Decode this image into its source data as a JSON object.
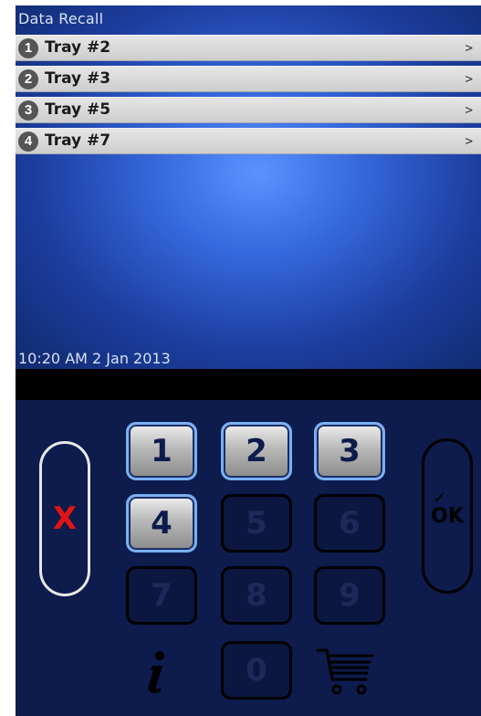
{
  "screen": {
    "title": "Data Recall",
    "items": [
      {
        "number": "1",
        "label": "Tray #2",
        "chevron": ">"
      },
      {
        "number": "2",
        "label": "Tray #3",
        "chevron": ">"
      },
      {
        "number": "3",
        "label": "Tray #5",
        "chevron": ">"
      },
      {
        "number": "4",
        "label": "Tray #7",
        "chevron": ">"
      }
    ],
    "datetime": "10:20 AM 2 Jan 2013"
  },
  "keypad": {
    "keys": [
      "1",
      "2",
      "3",
      "4",
      "5",
      "6",
      "7",
      "8",
      "9",
      "0"
    ],
    "enabled_keys": [
      "1",
      "2",
      "3",
      "4"
    ],
    "cancel_label": "X",
    "ok_label": "OK",
    "info_icon": "info-icon",
    "cart_icon": "shopping-cart-icon"
  },
  "colors": {
    "screen_center": "#5b92ff",
    "screen_edge": "#102a6c",
    "panel": "#0d1b4d",
    "cancel_x": "#e01414",
    "active_key_border": "#7bb0f2"
  }
}
